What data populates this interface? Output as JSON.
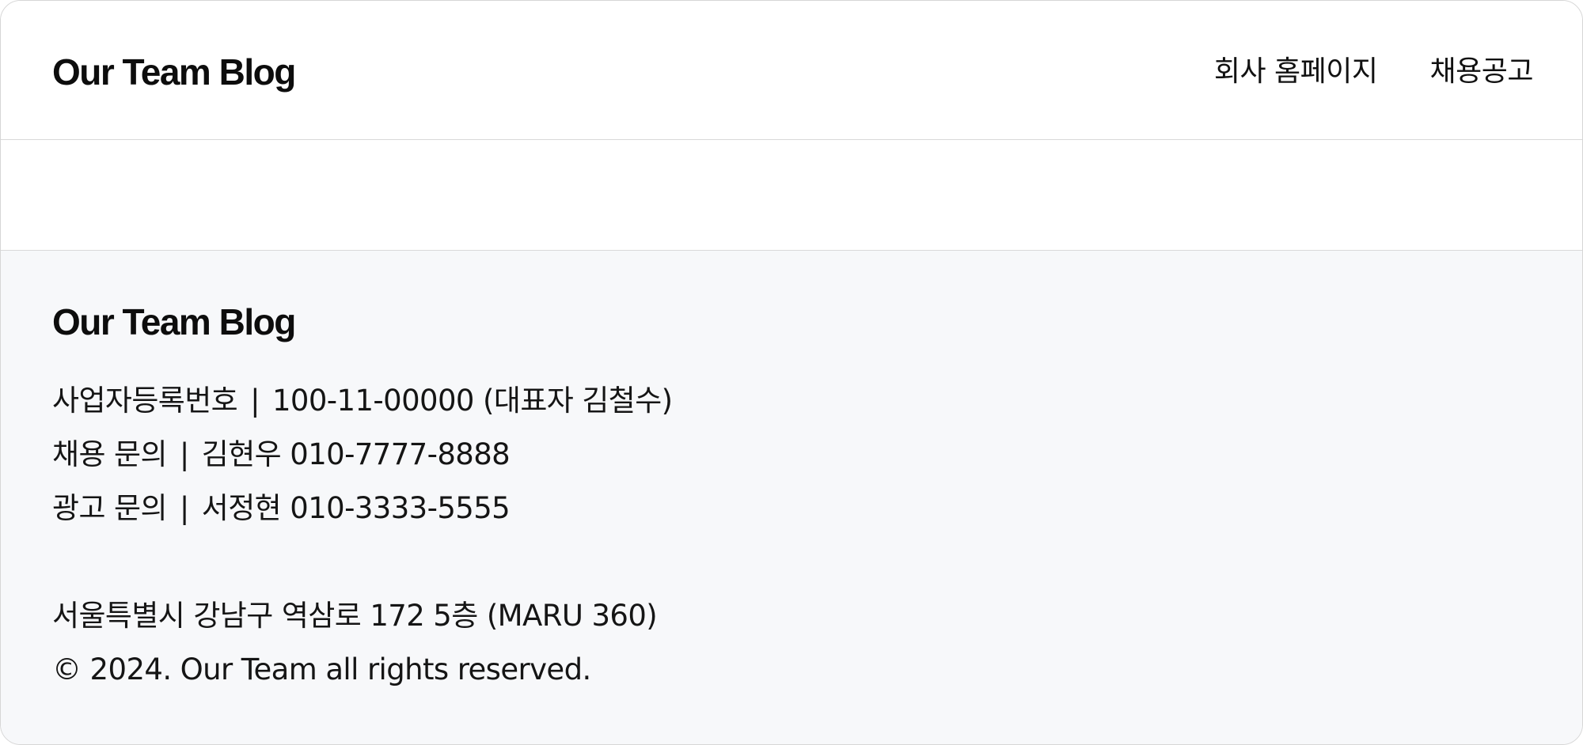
{
  "header": {
    "logo": "Our Team Blog",
    "nav": [
      {
        "label": "회사 홈페이지"
      },
      {
        "label": "채용공고"
      }
    ]
  },
  "footer": {
    "logo": "Our Team Blog",
    "separator": "|",
    "contacts": [
      {
        "label": "사업자등록번호",
        "value": "100-11-00000 (대표자 김철수)"
      },
      {
        "label": "채용 문의",
        "value": "김현우 010-7777-8888"
      },
      {
        "label": "광고 문의",
        "value": "서정현 010-3333-5555"
      }
    ],
    "address": "서울특별시 강남구 역삼로 172 5층 (MARU 360)",
    "copyright": "© 2024. Our Team all rights reserved."
  }
}
